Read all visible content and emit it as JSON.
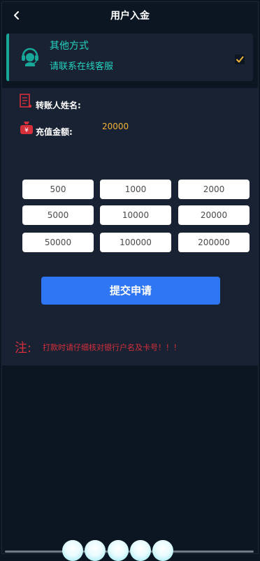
{
  "header": {
    "title": "用户入金"
  },
  "payment": {
    "title": "其他方式",
    "subtitle": "请联系在线客服",
    "selected": true,
    "accent_color": "#17a89a",
    "text_color": "#26d3c0",
    "check_color": "#f3b43a"
  },
  "form": {
    "name_label": "转账人姓名:",
    "name_value": "",
    "amount_label": "充值金额:",
    "amount_value": "20000"
  },
  "amounts": [
    "500",
    "1000",
    "2000",
    "5000",
    "10000",
    "20000",
    "50000",
    "100000",
    "200000"
  ],
  "submit_label": "提交申请",
  "note": {
    "label": "注:",
    "text": "打款时请仔细核对银行户名及卡号！！！"
  },
  "colors": {
    "background": "#0b1622",
    "panel": "#182232",
    "submit": "#2f76f4",
    "note": "#d62f3c"
  }
}
